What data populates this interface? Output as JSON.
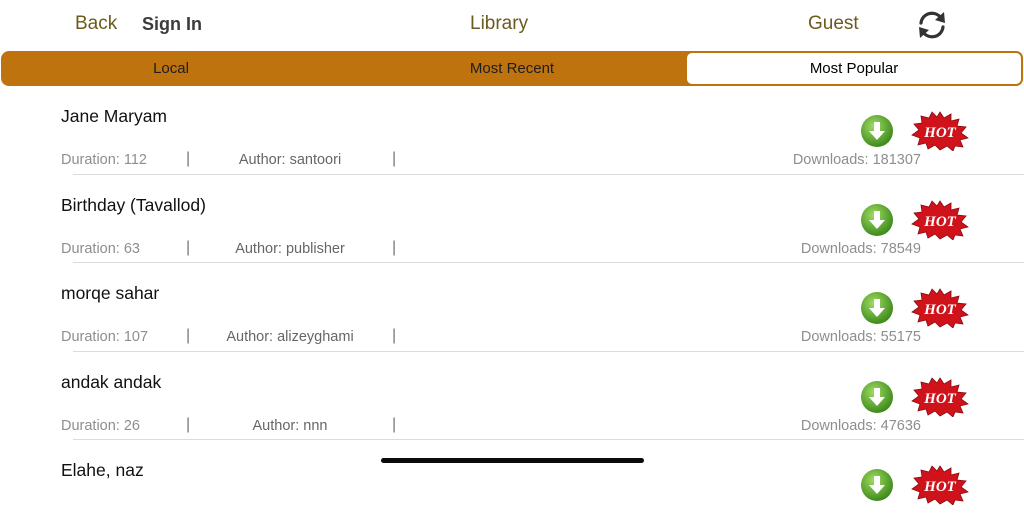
{
  "nav": {
    "back": "Back",
    "sign_in": "Sign In",
    "title": "Library",
    "user": "Guest"
  },
  "tabs": [
    {
      "label": "Local",
      "selected": false
    },
    {
      "label": "Most Recent",
      "selected": false
    },
    {
      "label": "Most Popular",
      "selected": true
    }
  ],
  "items": [
    {
      "name": "Jane Maryam",
      "duration": "Duration: 112",
      "author": "Author: santoori",
      "downloads": "Downloads: 181307"
    },
    {
      "name": "Birthday (Tavallod)",
      "duration": "Duration: 63",
      "author": "Author: publisher",
      "downloads": "Downloads: 78549"
    },
    {
      "name": "morqe sahar",
      "duration": "Duration: 107",
      "author": "Author: alizeyghami",
      "downloads": "Downloads: 55175"
    },
    {
      "name": "andak andak",
      "duration": "Duration: 26",
      "author": "Author: nnn",
      "downloads": "Downloads: 47636"
    },
    {
      "name": "Elahe, naz",
      "duration": "",
      "author": "",
      "downloads": ""
    }
  ],
  "badge": "HOT",
  "colors": {
    "accent": "#be730f",
    "nav_text": "#6b5b1e",
    "download_green": "#5aa52c",
    "hot_red": "#d0121b"
  },
  "icons": {
    "refresh": "refresh-icon",
    "download": "download-arrow-icon",
    "hot": "hot-badge-icon"
  }
}
